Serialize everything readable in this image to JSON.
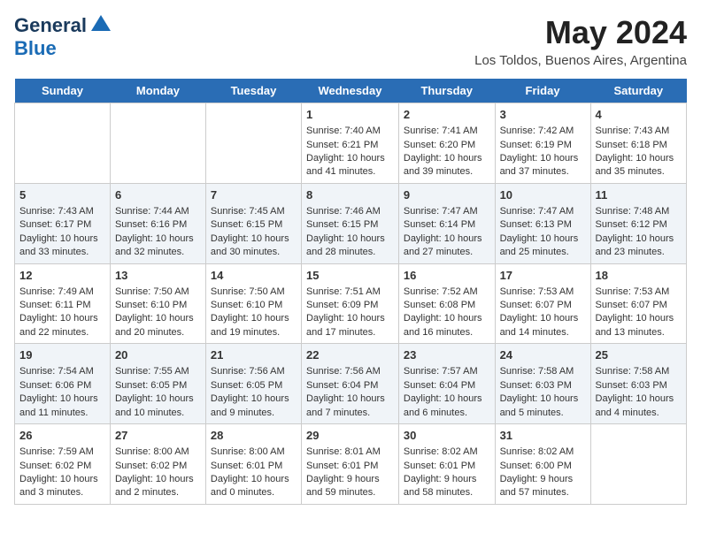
{
  "logo": {
    "line1": "General",
    "line2": "Blue",
    "tagline": ""
  },
  "title": "May 2024",
  "subtitle": "Los Toldos, Buenos Aires, Argentina",
  "headers": [
    "Sunday",
    "Monday",
    "Tuesday",
    "Wednesday",
    "Thursday",
    "Friday",
    "Saturday"
  ],
  "weeks": [
    [
      {
        "day": "",
        "info": ""
      },
      {
        "day": "",
        "info": ""
      },
      {
        "day": "",
        "info": ""
      },
      {
        "day": "1",
        "info": "Sunrise: 7:40 AM\nSunset: 6:21 PM\nDaylight: 10 hours\nand 41 minutes."
      },
      {
        "day": "2",
        "info": "Sunrise: 7:41 AM\nSunset: 6:20 PM\nDaylight: 10 hours\nand 39 minutes."
      },
      {
        "day": "3",
        "info": "Sunrise: 7:42 AM\nSunset: 6:19 PM\nDaylight: 10 hours\nand 37 minutes."
      },
      {
        "day": "4",
        "info": "Sunrise: 7:43 AM\nSunset: 6:18 PM\nDaylight: 10 hours\nand 35 minutes."
      }
    ],
    [
      {
        "day": "5",
        "info": "Sunrise: 7:43 AM\nSunset: 6:17 PM\nDaylight: 10 hours\nand 33 minutes."
      },
      {
        "day": "6",
        "info": "Sunrise: 7:44 AM\nSunset: 6:16 PM\nDaylight: 10 hours\nand 32 minutes."
      },
      {
        "day": "7",
        "info": "Sunrise: 7:45 AM\nSunset: 6:15 PM\nDaylight: 10 hours\nand 30 minutes."
      },
      {
        "day": "8",
        "info": "Sunrise: 7:46 AM\nSunset: 6:15 PM\nDaylight: 10 hours\nand 28 minutes."
      },
      {
        "day": "9",
        "info": "Sunrise: 7:47 AM\nSunset: 6:14 PM\nDaylight: 10 hours\nand 27 minutes."
      },
      {
        "day": "10",
        "info": "Sunrise: 7:47 AM\nSunset: 6:13 PM\nDaylight: 10 hours\nand 25 minutes."
      },
      {
        "day": "11",
        "info": "Sunrise: 7:48 AM\nSunset: 6:12 PM\nDaylight: 10 hours\nand 23 minutes."
      }
    ],
    [
      {
        "day": "12",
        "info": "Sunrise: 7:49 AM\nSunset: 6:11 PM\nDaylight: 10 hours\nand 22 minutes."
      },
      {
        "day": "13",
        "info": "Sunrise: 7:50 AM\nSunset: 6:10 PM\nDaylight: 10 hours\nand 20 minutes."
      },
      {
        "day": "14",
        "info": "Sunrise: 7:50 AM\nSunset: 6:10 PM\nDaylight: 10 hours\nand 19 minutes."
      },
      {
        "day": "15",
        "info": "Sunrise: 7:51 AM\nSunset: 6:09 PM\nDaylight: 10 hours\nand 17 minutes."
      },
      {
        "day": "16",
        "info": "Sunrise: 7:52 AM\nSunset: 6:08 PM\nDaylight: 10 hours\nand 16 minutes."
      },
      {
        "day": "17",
        "info": "Sunrise: 7:53 AM\nSunset: 6:07 PM\nDaylight: 10 hours\nand 14 minutes."
      },
      {
        "day": "18",
        "info": "Sunrise: 7:53 AM\nSunset: 6:07 PM\nDaylight: 10 hours\nand 13 minutes."
      }
    ],
    [
      {
        "day": "19",
        "info": "Sunrise: 7:54 AM\nSunset: 6:06 PM\nDaylight: 10 hours\nand 11 minutes."
      },
      {
        "day": "20",
        "info": "Sunrise: 7:55 AM\nSunset: 6:05 PM\nDaylight: 10 hours\nand 10 minutes."
      },
      {
        "day": "21",
        "info": "Sunrise: 7:56 AM\nSunset: 6:05 PM\nDaylight: 10 hours\nand 9 minutes."
      },
      {
        "day": "22",
        "info": "Sunrise: 7:56 AM\nSunset: 6:04 PM\nDaylight: 10 hours\nand 7 minutes."
      },
      {
        "day": "23",
        "info": "Sunrise: 7:57 AM\nSunset: 6:04 PM\nDaylight: 10 hours\nand 6 minutes."
      },
      {
        "day": "24",
        "info": "Sunrise: 7:58 AM\nSunset: 6:03 PM\nDaylight: 10 hours\nand 5 minutes."
      },
      {
        "day": "25",
        "info": "Sunrise: 7:58 AM\nSunset: 6:03 PM\nDaylight: 10 hours\nand 4 minutes."
      }
    ],
    [
      {
        "day": "26",
        "info": "Sunrise: 7:59 AM\nSunset: 6:02 PM\nDaylight: 10 hours\nand 3 minutes."
      },
      {
        "day": "27",
        "info": "Sunrise: 8:00 AM\nSunset: 6:02 PM\nDaylight: 10 hours\nand 2 minutes."
      },
      {
        "day": "28",
        "info": "Sunrise: 8:00 AM\nSunset: 6:01 PM\nDaylight: 10 hours\nand 0 minutes."
      },
      {
        "day": "29",
        "info": "Sunrise: 8:01 AM\nSunset: 6:01 PM\nDaylight: 9 hours\nand 59 minutes."
      },
      {
        "day": "30",
        "info": "Sunrise: 8:02 AM\nSunset: 6:01 PM\nDaylight: 9 hours\nand 58 minutes."
      },
      {
        "day": "31",
        "info": "Sunrise: 8:02 AM\nSunset: 6:00 PM\nDaylight: 9 hours\nand 57 minutes."
      },
      {
        "day": "",
        "info": ""
      }
    ]
  ]
}
